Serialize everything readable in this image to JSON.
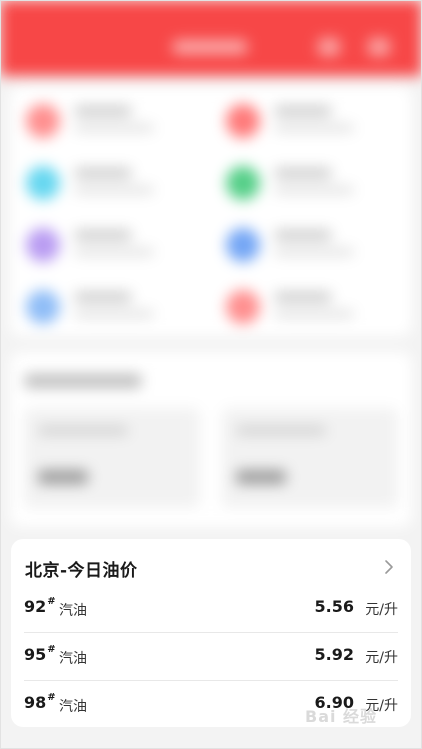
{
  "price_panel": {
    "title": "北京-今日油价",
    "rows": [
      {
        "grade": "92",
        "grade_mark": "#",
        "fuel": "汽油",
        "price": "5.56",
        "unit": "元/升"
      },
      {
        "grade": "95",
        "grade_mark": "#",
        "fuel": "汽油",
        "price": "5.92",
        "unit": "元/升"
      },
      {
        "grade": "98",
        "grade_mark": "#",
        "fuel": "汽油",
        "price": "6.90",
        "unit": "元/升"
      }
    ]
  },
  "watermark": "Bai 经验",
  "colors": {
    "header": "#f74747",
    "service_icons": [
      "#ff8f8f",
      "#ff7a7a",
      "#66d7f0",
      "#55cf88",
      "#b99cf2",
      "#74a6f5",
      "#8fbdf7",
      "#ff8f8f"
    ]
  },
  "icons": {
    "chevron": "chevron-right-icon"
  }
}
